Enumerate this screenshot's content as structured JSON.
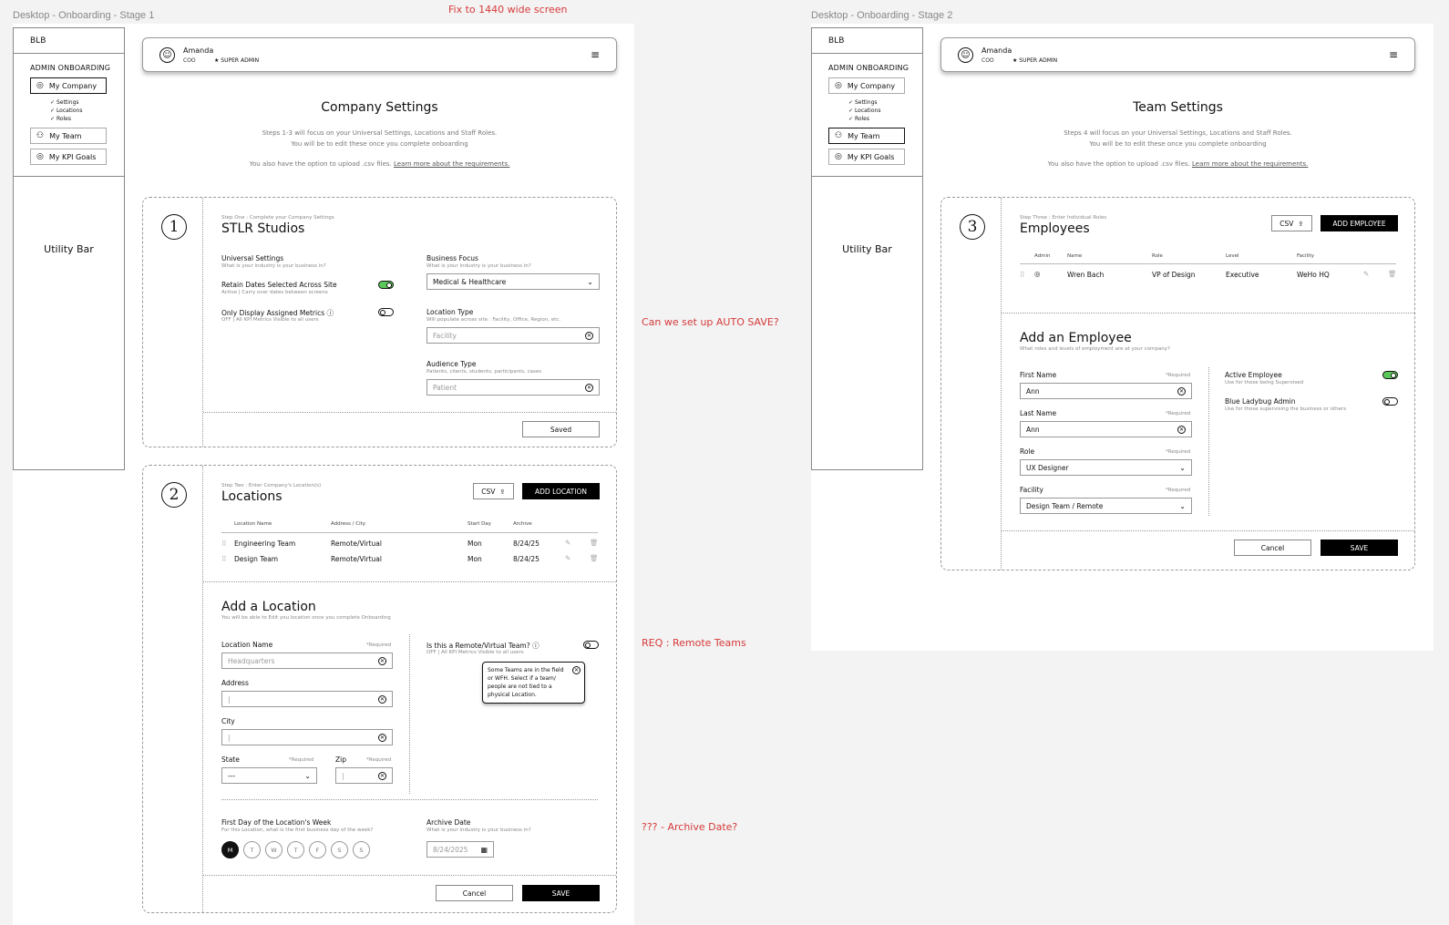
{
  "stage1_label": "Desktop - Onboarding - Stage 1",
  "stage2_label": "Desktop - Onboarding - Stage 2",
  "notes": {
    "wide_screen": "Fix to 1440 wide screen",
    "autosave": "Can we set up AUTO SAVE?",
    "remote_teams": "REQ : Remote Teams",
    "archive": "??? - Archive Date?"
  },
  "sidebar": {
    "logo": "BLB",
    "heading": "ADMIN ONBOARDING",
    "items": {
      "company": "My Company",
      "team": "My Team",
      "kpi": "My KPI Goals"
    },
    "subitems": [
      "Settings",
      "Locations",
      "Roles"
    ],
    "utility": "Utility Bar"
  },
  "header": {
    "name": "Amanda",
    "role": "COO",
    "badge": "★ SUPER ADMIN",
    "menu_icon": "hamburger-icon"
  },
  "stage1": {
    "title": "Company Settings",
    "intro1": "Steps 1-3 will focus on your Universal Settings, Locations and Staff Roles.",
    "intro2": "You will be to edit these once you complete onboarding",
    "csv_text": "You also have the option to upload .csv files.",
    "csv_link": "Learn more about the requirements.",
    "step1": {
      "number": "1",
      "label": "Step One : Complete your Company Settings",
      "title": "STLR Studios",
      "universal_label": "Universal Settings",
      "universal_sub": "What is your industry is your business in?",
      "retain_label": "Retain Dates Selected Across Site",
      "retain_sub": "Active | Carry over dates between screens",
      "only_label": "Only Display Assigned Metrics ⓘ",
      "only_sub": "OFF | All KPI Metrics Visible to all users",
      "focus_label": "Business Focus",
      "focus_sub": "What is your industry is your business in?",
      "focus_value": "Medical & Healthcare",
      "loc_type_label": "Location Type",
      "loc_type_sub": "Will populate across site : Facility, Office, Region, etc.",
      "loc_type_placeholder": "Facility",
      "aud_label": "Audience Type",
      "aud_sub": "Patients, clients, students, participants, cases",
      "aud_placeholder": "Patient",
      "saved": "Saved"
    },
    "step2": {
      "number": "2",
      "label": "Step Two : Enter Company's Location(s)",
      "title": "Locations",
      "csv": "CSV",
      "add": "ADD LOCATION",
      "headers": [
        "Location Name",
        "Address / City",
        "Start Day",
        "Archive"
      ],
      "rows": [
        {
          "name": "Engineering Team",
          "address": "Remote/Virtual",
          "day": "Mon",
          "archive": "8/24/25"
        },
        {
          "name": "Design Team",
          "address": "Remote/Virtual",
          "day": "Mon",
          "archive": "8/24/25"
        }
      ],
      "add_title": "Add a Location",
      "add_sub": "You will be able to Edit you location once you complete Onboarding",
      "loc_name_label": "Location Name",
      "required": "*Required",
      "loc_name_placeholder": "Headquarters",
      "address_label": "Address",
      "city_label": "City",
      "state_label": "State",
      "state_value": "---",
      "zip_label": "Zip",
      "remote_label": "Is this a Remote/Virtual Team? ⓘ",
      "remote_sub": "OFF | All KPI Metrics Visible to all users",
      "tooltip": "Some Teams are in the field or WFH. Select if a team/ people are not tied to a physical Location.",
      "first_day_label": "First Day of the Location's Week",
      "first_day_sub": "For this Location, what is the first business day of the week?",
      "days": [
        "M",
        "T",
        "W",
        "T",
        "F",
        "S",
        "S"
      ],
      "archive_label": "Archive Date",
      "archive_sub": "What is your industry is your business in?",
      "archive_value": "8/24/2025",
      "cancel": "Cancel",
      "save": "SAVE"
    }
  },
  "stage2": {
    "title": "Team Settings",
    "intro1": "Steps 4 will focus on your Universal Settings, Locations and Staff Roles.",
    "intro2": "You will be to edit these once you complete onboarding",
    "csv_text": "You also have the option to upload .csv files.",
    "csv_link": "Learn more about the requirements.",
    "step3": {
      "number": "3",
      "label": "Step Three : Enter Individual Roles",
      "title": "Employees",
      "csv": "CSV",
      "add": "ADD EMPLOYEE",
      "headers": [
        "Admin",
        "Name",
        "Role",
        "Level",
        "Facility"
      ],
      "row": {
        "name": "Wren Bach",
        "role": "VP of Design",
        "level": "Executive",
        "facility": "WeHo HQ"
      },
      "add_title": "Add an Employee",
      "add_sub": "What roles and levels of employment are at your company?",
      "required": "*Required",
      "first_label": "First Name",
      "first_value": "Ann",
      "last_label": "Last Name",
      "last_value": "Ann",
      "role_label": "Role",
      "role_value": "UX Designer",
      "facility_label": "Facility",
      "facility_value": "Design Team / Remote",
      "active_label": "Active Employee",
      "active_sub": "Use for those being Supervised",
      "bl_label": "Blue Ladybug Admin",
      "bl_sub": "Use for those supervising the business or others",
      "cancel": "Cancel",
      "save": "SAVE"
    }
  }
}
